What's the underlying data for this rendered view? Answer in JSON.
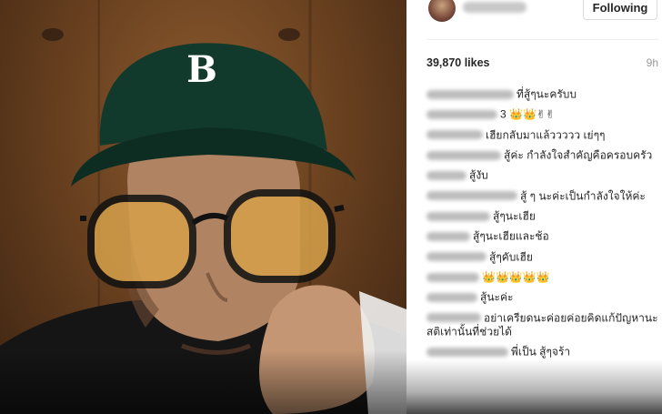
{
  "post": {
    "follow_label": "Following",
    "likes": "39,870 likes",
    "time": "9h"
  },
  "comments": [
    {
      "text": "ที่สู้ๆนะครับบ"
    },
    {
      "text": "3 👑👑✌✌"
    },
    {
      "text": "เฮียกลับมาแล้ววววว เย่ๆๆ"
    },
    {
      "text": "สู้ค่ะ กำลังใจสำคัญคือครอบครัว"
    },
    {
      "text": "สู้งับ"
    },
    {
      "text": "สู้ ๆ นะค่ะเป็นกำลังใจให้ค่ะ"
    },
    {
      "text": "สู้ๆนะเฮีย"
    },
    {
      "text": "สู้ๆนะเฮียและช้อ"
    },
    {
      "text": "สู้ๆคับเฮีย"
    },
    {
      "text": "👑👑👑👑👑"
    },
    {
      "text": "สู้นะค่ะ"
    },
    {
      "text": "อย่าเครียดนะค่อยค่อยคิดแก้ปัญหานะสติเท่านั้นที่ช่วยได้"
    },
    {
      "text": "พี่เป็น สู้ๆจร้า"
    }
  ],
  "icons": {
    "cap_logo": "B"
  }
}
